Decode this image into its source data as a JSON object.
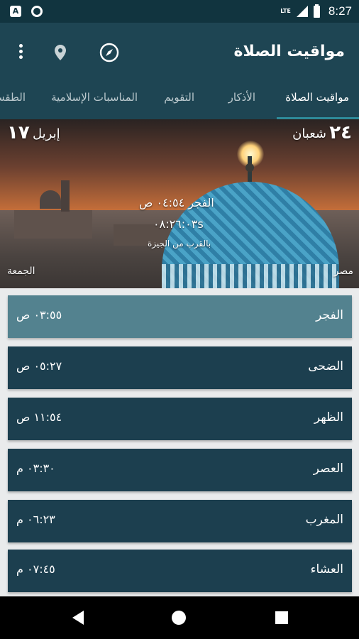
{
  "status_bar": {
    "lte": "LTE",
    "time": "8:27"
  },
  "app_bar": {
    "title": "مواقيت الصلاة"
  },
  "tabs": [
    {
      "label": "مواقيت الصلاة",
      "active": true
    },
    {
      "label": "الأذكار"
    },
    {
      "label": "التقويم"
    },
    {
      "label": "المناسبات الإسلامية"
    },
    {
      "label": "الطقس"
    }
  ],
  "hero": {
    "hijri_day": "٢٤",
    "hijri_month": "شعبان",
    "greg_day": "١٧",
    "greg_month": "إبريل",
    "next_prayer": "الفجر ٠٤:٥٤ ص",
    "countdown": "٠٨:٢٦:٠٣s",
    "location": "بالقرب من الجيزة",
    "country": "مصر",
    "weekday": "الجمعة"
  },
  "prayers": [
    {
      "name": "الفجر",
      "time": "٠٣:٥٥ ص",
      "current": true
    },
    {
      "name": "الضحى",
      "time": "٠٥:٢٧ ص"
    },
    {
      "name": "الظهر",
      "time": "١١:٥٤ ص"
    },
    {
      "name": "العصر",
      "time": "٠٣:٣٠ م"
    },
    {
      "name": "المغرب",
      "time": "٠٦:٢٣ م"
    },
    {
      "name": "العشاء",
      "time": "٠٧:٤٥ م"
    }
  ],
  "colors": {
    "app_bar": "#1e4553",
    "card": "#1c3f4f",
    "card_current": "#53828f",
    "tab_indicator": "#2e8b9a"
  }
}
